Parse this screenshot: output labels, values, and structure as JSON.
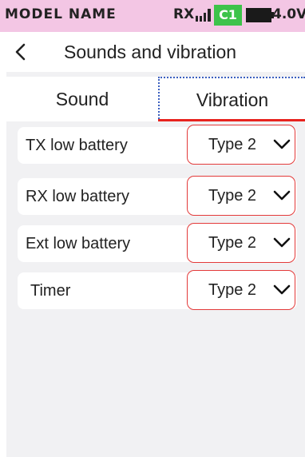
{
  "status_bar": {
    "model_name": "MODEL NAME",
    "receiver_label": "RX.",
    "signal_icon": "signal-bars-icon",
    "channel": "C1",
    "battery_icon": "battery-icon",
    "voltage": "4.0V",
    "background_color": "#f3c6e4",
    "channel_color": "#3dc34a"
  },
  "header": {
    "back_icon": "chevron-left-icon",
    "title": "Sounds and vibration"
  },
  "tabs": [
    {
      "label": "Sound",
      "selected": false
    },
    {
      "label": "Vibration",
      "selected": true
    }
  ],
  "accent_color": "#e8231e",
  "settings": [
    {
      "label": "TX low battery",
      "value": "Type 2"
    },
    {
      "label": "RX low battery",
      "value": "Type 2"
    },
    {
      "label": "Ext low battery",
      "value": "Type 2"
    },
    {
      "label": "Timer",
      "value": "Type 2"
    }
  ]
}
